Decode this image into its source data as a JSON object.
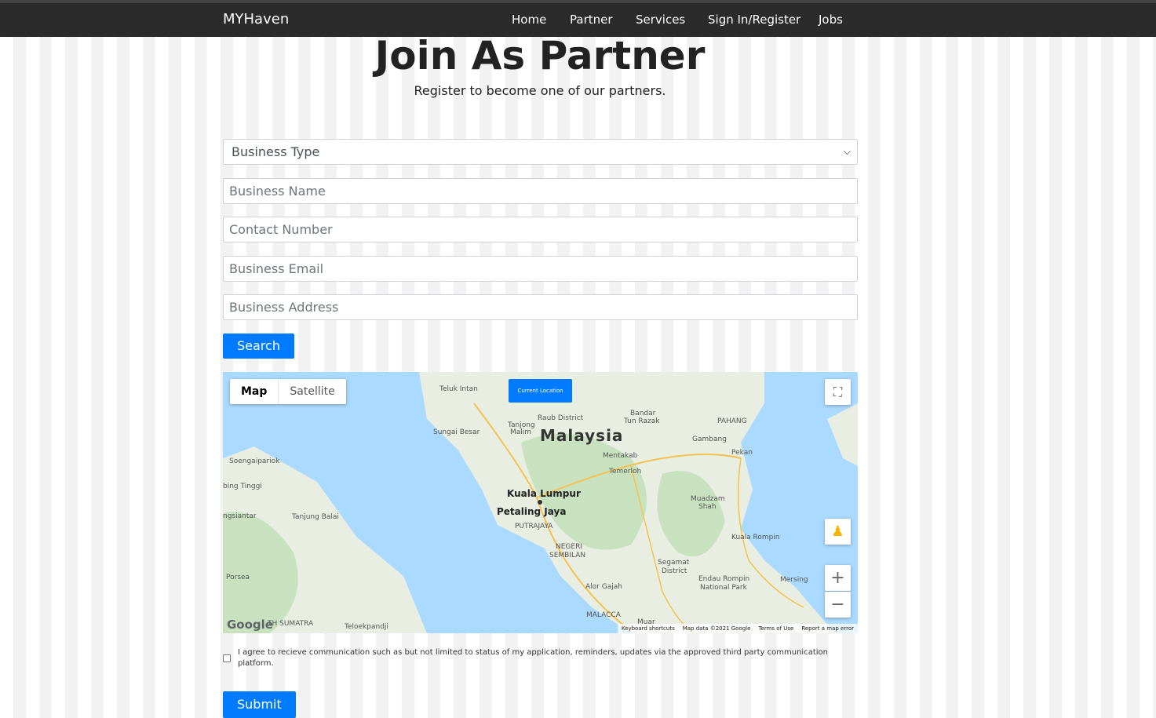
{
  "navbar": {
    "brand": "MYHaven",
    "links": [
      "Home",
      "Partner",
      "Services",
      "Sign In/Register",
      "Jobs"
    ]
  },
  "header": {
    "title": "Join As Partner",
    "subtitle": "Register to become one of our partners."
  },
  "form": {
    "business_type": "Business Type",
    "business_name_placeholder": "Business Name",
    "contact_number_placeholder": "Contact Number",
    "business_email_placeholder": "Business Email",
    "business_address_placeholder": "Business Address",
    "search_label": "Search",
    "consent_text": "I agree to recieve communication such as but not limited to status of my application, reminders, updates via the approved third party communication platform.",
    "submit_label": "Submit"
  },
  "map": {
    "map_type_map": "Map",
    "map_type_satellite": "Satellite",
    "current_location_label": "Current Location",
    "labels": {
      "country": "Malaysia",
      "kl": "Kuala Lumpur",
      "pj": "Petaling Jaya",
      "putrajaya": "PUTRAJAYA",
      "negeri": "NEGERI",
      "sembilan": "SEMBILAN",
      "teluk_intan": "Teluk Intan",
      "raub": "Raub District",
      "bandar": "Bandar",
      "tun_razak": "Tun Razak",
      "pahang": "PAHANG",
      "gambang": "Gambang",
      "pekan": "Pekan",
      "mentakab": "Mentakab",
      "temerloh": "Temerloh",
      "sungai_besar": "Sungai Besar",
      "tanjong": "Tanjong",
      "malim": "Malim",
      "muadzam": "Muadzam",
      "shah": "Shah",
      "kuala_rompin": "Kuala Rompin",
      "segamat": "Segamat",
      "district": "District",
      "endau": "Endau Rompin",
      "national_park": "National Park",
      "mersing": "Mersing",
      "alor_gajah": "Alor Gajah",
      "malacca": "MALACCA",
      "soengai": "Soengaipariok",
      "bing_tinggi": "bing Tinggi",
      "ngsiantar": "ngsiantar",
      "tanjung_balai": "Tanjung Balai",
      "porsea": "Porsea",
      "sumatra": "TH SUMATRA",
      "teloek": "Teloekpandji",
      "muar": "Muar"
    },
    "google_logo": "Google",
    "footer": [
      "Keyboard shortcuts",
      "Map data ©2021 Google",
      "Terms of Use",
      "Report a map error"
    ],
    "colors": {
      "water": "#aadaff",
      "land": "#e8eee2",
      "forest": "#c8e2c0"
    }
  },
  "colors": {
    "primary": "#007bff",
    "navbar": "#2b2b2b"
  }
}
